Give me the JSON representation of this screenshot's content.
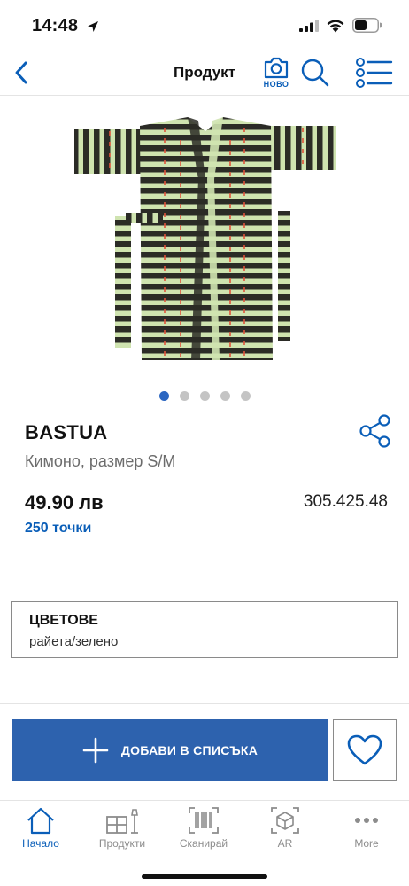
{
  "status_bar": {
    "time": "14:48"
  },
  "nav": {
    "title": "Продукт",
    "camera_badge": "НОВО"
  },
  "product": {
    "name": "BASTUA",
    "description": "Кимоно, размер S/M",
    "price": "49.90 лв",
    "article_number": "305.425.48",
    "points": "250 точки",
    "image_colors": {
      "dark": "#2b2b26",
      "light": "#cfe3b0",
      "accent": "#e0533b"
    }
  },
  "carousel": {
    "count": 5,
    "active_index": 0
  },
  "colors": {
    "title": "ЦВЕТОВЕ",
    "value": "райета/зелено"
  },
  "actions": {
    "add_to_list_label": "ДОБАВИ В СПИСЪКА"
  },
  "tab_bar": {
    "items": [
      {
        "label": "Начало",
        "icon": "home-icon",
        "active": true
      },
      {
        "label": "Продукти",
        "icon": "furniture-icon",
        "active": false
      },
      {
        "label": "Сканирай",
        "icon": "barcode-icon",
        "active": false
      },
      {
        "label": "AR",
        "icon": "ar-icon",
        "active": false
      },
      {
        "label": "More",
        "icon": "more-icon",
        "active": false
      }
    ]
  },
  "theme": {
    "brand_blue": "#0a5eb8",
    "button_blue": "#2d62ae",
    "active_dot": "#2b66c1"
  }
}
